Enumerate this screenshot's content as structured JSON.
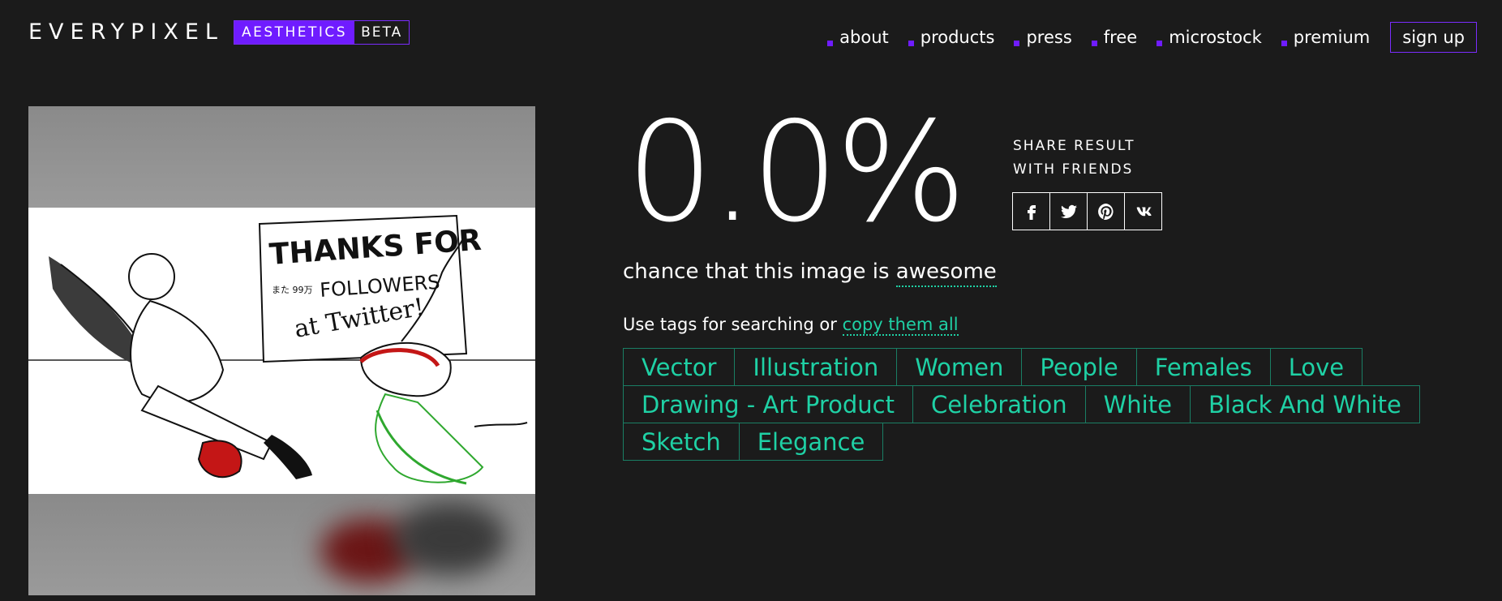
{
  "header": {
    "logo_text": "EVERYPIXEL",
    "badge_main": "AESTHETICS",
    "badge_beta": "BETA",
    "nav": [
      {
        "label": "about"
      },
      {
        "label": "products"
      },
      {
        "label": "press"
      },
      {
        "label": "free"
      },
      {
        "label": "microstock"
      },
      {
        "label": "premium"
      }
    ],
    "signup_label": "sign up"
  },
  "image": {
    "sign_line1": "THANKS FOR",
    "sign_line2": "また 99万",
    "sign_line3": "FOLLOWERS",
    "sign_line4": "at Twitter!"
  },
  "result": {
    "score": "0.0%",
    "chance_prefix": "chance that this image is ",
    "chance_keyword": "awesome"
  },
  "share": {
    "label_line1": "SHARE RESULT",
    "label_line2": "WITH FRIENDS",
    "buttons": [
      {
        "icon": "facebook-icon"
      },
      {
        "icon": "twitter-icon"
      },
      {
        "icon": "pinterest-icon"
      },
      {
        "icon": "vk-icon"
      }
    ]
  },
  "tags_section": {
    "hint_prefix": "Use tags for searching or ",
    "copy_all_label": "copy them all",
    "rows": [
      [
        "Vector",
        "Illustration",
        "Women",
        "People",
        "Females",
        "Love"
      ],
      [
        "Drawing - Art Product",
        "Celebration",
        "White",
        "Black And White"
      ],
      [
        "Sketch",
        "Elegance"
      ]
    ]
  },
  "colors": {
    "background": "#1b1b1b",
    "accent_purple": "#6f1cff",
    "tag_teal": "#1fd1a5",
    "tag_border": "#1a7e64"
  }
}
